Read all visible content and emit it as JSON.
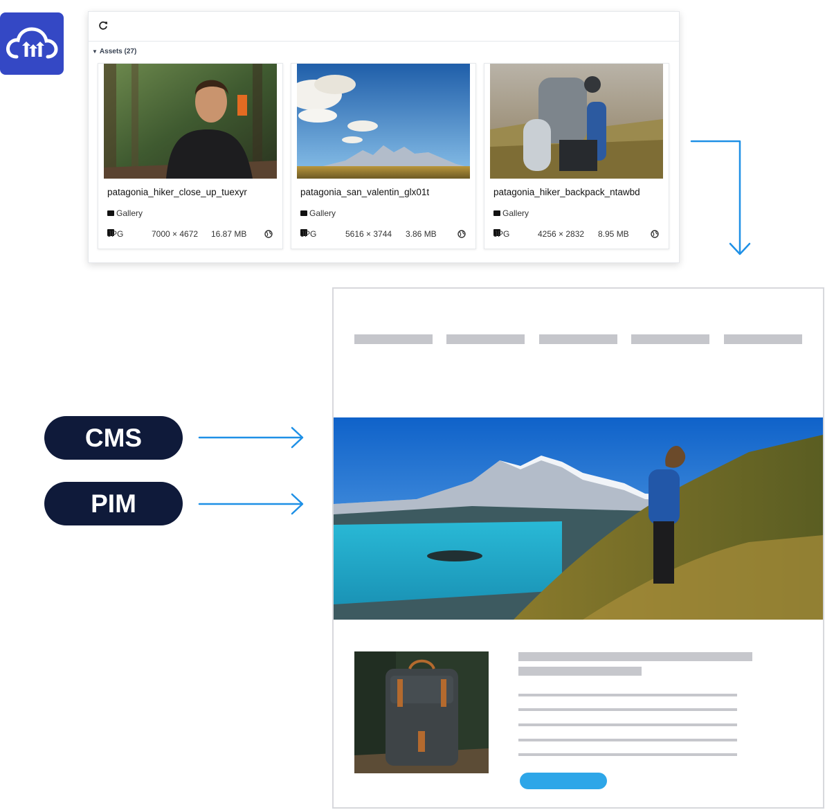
{
  "logo": {
    "icon": "cloudinary-cloud-icon",
    "color": "#3448c5"
  },
  "dam": {
    "refresh_icon": "refresh-icon",
    "assets_label": "Assets (27)",
    "cards": [
      {
        "name": "patagonia_hiker_close_up_tuexyr",
        "folder": "Gallery",
        "format": "JPG",
        "dimensions": "7000 × 4672",
        "size": "16.87 MB"
      },
      {
        "name": "patagonia_san_valentin_glx01t",
        "folder": "Gallery",
        "format": "JPG",
        "dimensions": "5616 × 3744",
        "size": "3.86 MB"
      },
      {
        "name": "patagonia_hiker_backpack_ntawbd",
        "folder": "Gallery",
        "format": "JPG",
        "dimensions": "4256 × 2832",
        "size": "8.95 MB"
      }
    ]
  },
  "labels": {
    "cms": "CMS",
    "pim": "PIM"
  },
  "colors": {
    "arrow": "#1e90e6",
    "pill": "#0f1a3a",
    "cta": "#2ea6e8",
    "placeholder": "#c5c6cb"
  }
}
